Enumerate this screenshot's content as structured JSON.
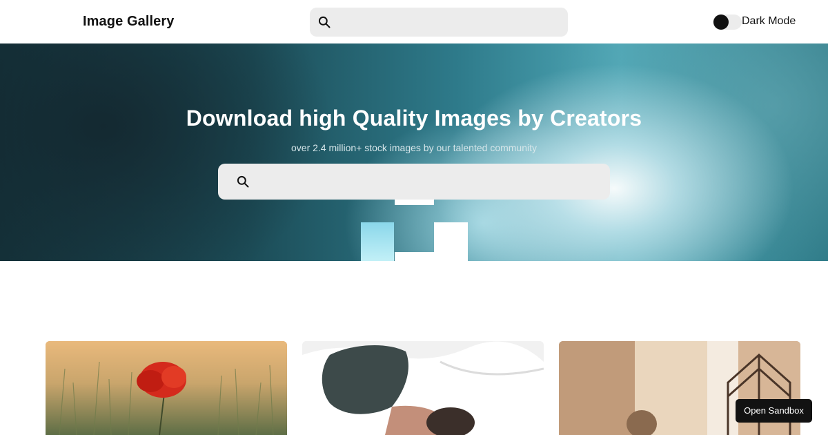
{
  "header": {
    "logo": "Image Gallery",
    "search": {
      "value": "",
      "placeholder": "",
      "icon": "search-icon"
    },
    "dark_mode": {
      "label": "Dark Mode",
      "enabled": false
    }
  },
  "hero": {
    "title": "Download high Quality Images by Creators",
    "subtitle": "over 2.4 million+ stock images by our talented community",
    "search": {
      "value": "",
      "placeholder": "",
      "icon": "search-icon"
    }
  },
  "gallery": {
    "cards": [
      {
        "subject": "red poppy in field"
      },
      {
        "subject": "man sleeping on bed"
      },
      {
        "subject": "room with window and curtain"
      }
    ]
  },
  "sandbox_button": {
    "label": "Open Sandbox"
  }
}
